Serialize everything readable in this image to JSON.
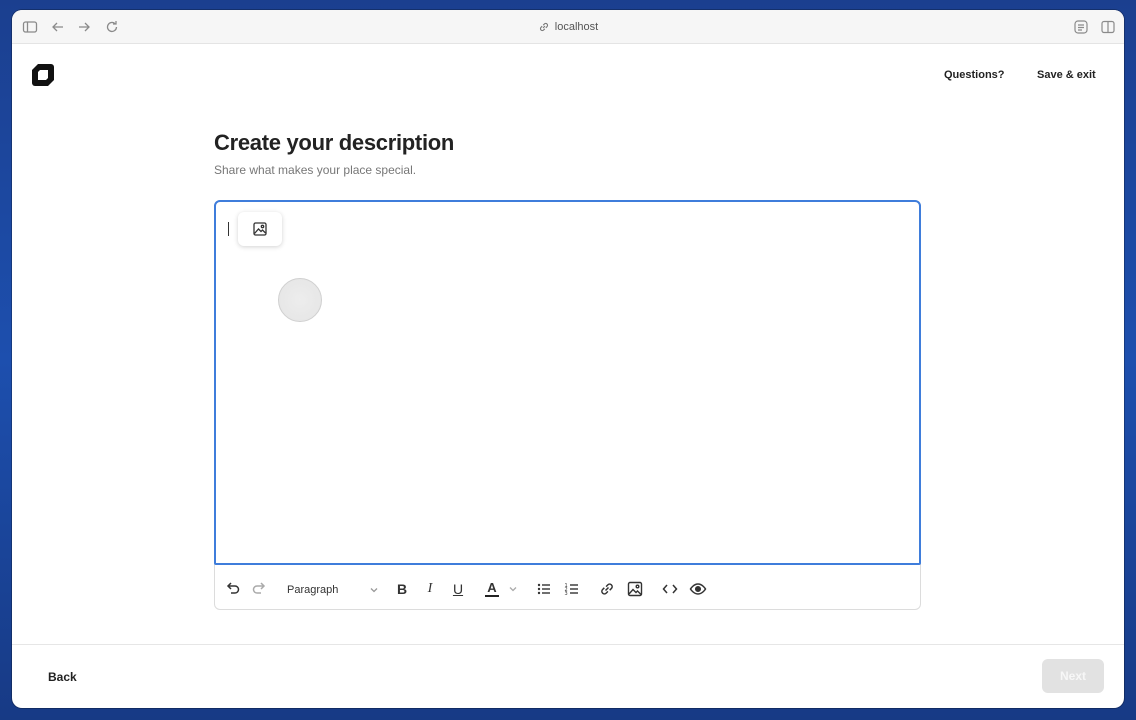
{
  "browser": {
    "url": "localhost",
    "icons": [
      "sidebar-icon",
      "back-arrow-icon",
      "forward-arrow-icon",
      "reload-icon",
      "link-icon",
      "reader-icon",
      "split-view-icon"
    ]
  },
  "header": {
    "questions_label": "Questions?",
    "save_exit_label": "Save & exit"
  },
  "main": {
    "title": "Create your description",
    "subtitle": "Share what makes your place special."
  },
  "editor": {
    "content": "",
    "toolbar": {
      "block_format": "Paragraph",
      "bold": "B",
      "italic": "I",
      "underline": "U",
      "text_color": "A"
    }
  },
  "footer": {
    "back_label": "Back",
    "next_label": "Next"
  },
  "colors": {
    "accent_focus": "#3f7ddb",
    "next_disabled": "#e2e2e2",
    "text_primary": "#222222"
  }
}
